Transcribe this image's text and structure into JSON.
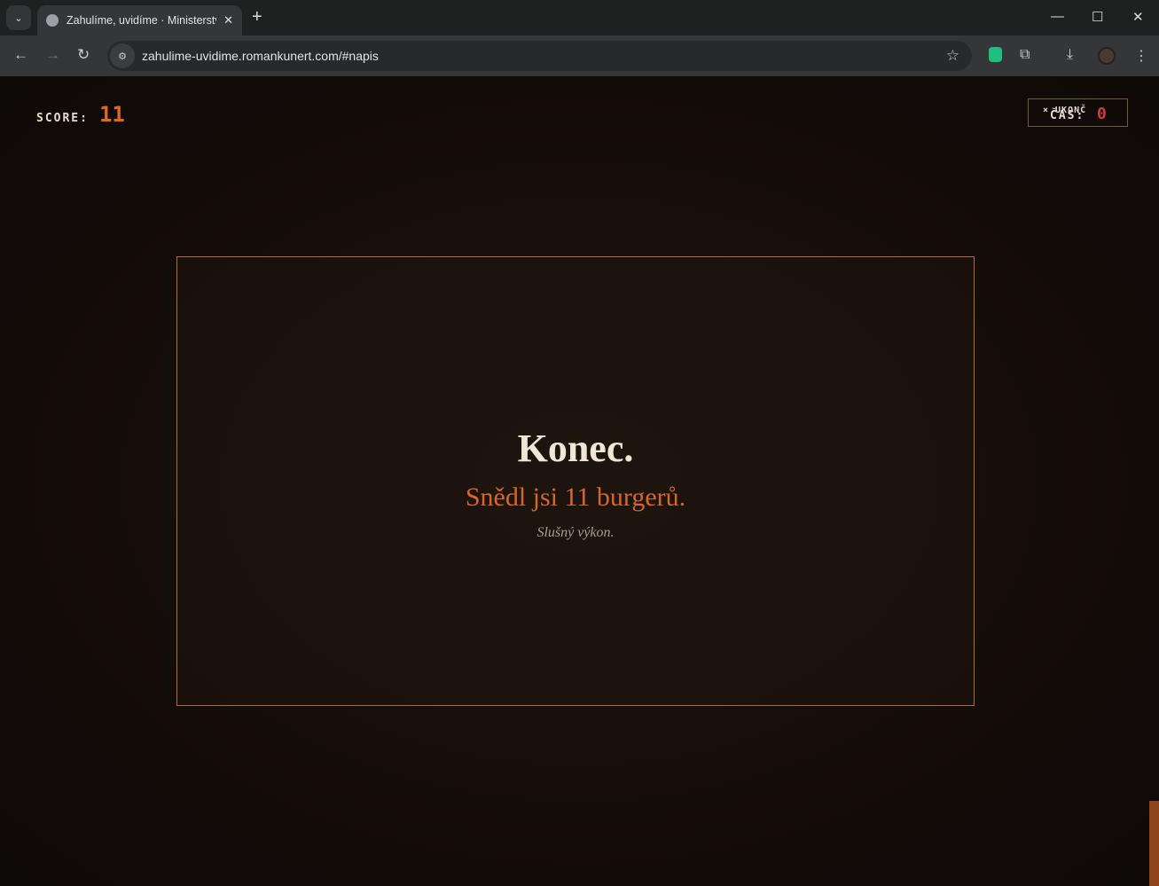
{
  "browser": {
    "tab_title": "Zahulíme, uvidíme · Ministerstvo",
    "url": "zahulime-uvidime.romankunert.com/#napis"
  },
  "game": {
    "score_label": "SCORE:",
    "score_value": "11",
    "quit_label": "× UKONČ",
    "time_label": "ČAS:",
    "time_value": "0"
  },
  "end_screen": {
    "title": "Konec.",
    "result": "Snědl jsi 11 burgerů.",
    "verdict": "Slušný výkon."
  },
  "colors": {
    "accent": "#e0681e",
    "danger": "#d23a3a",
    "text": "#f1e6d6"
  }
}
